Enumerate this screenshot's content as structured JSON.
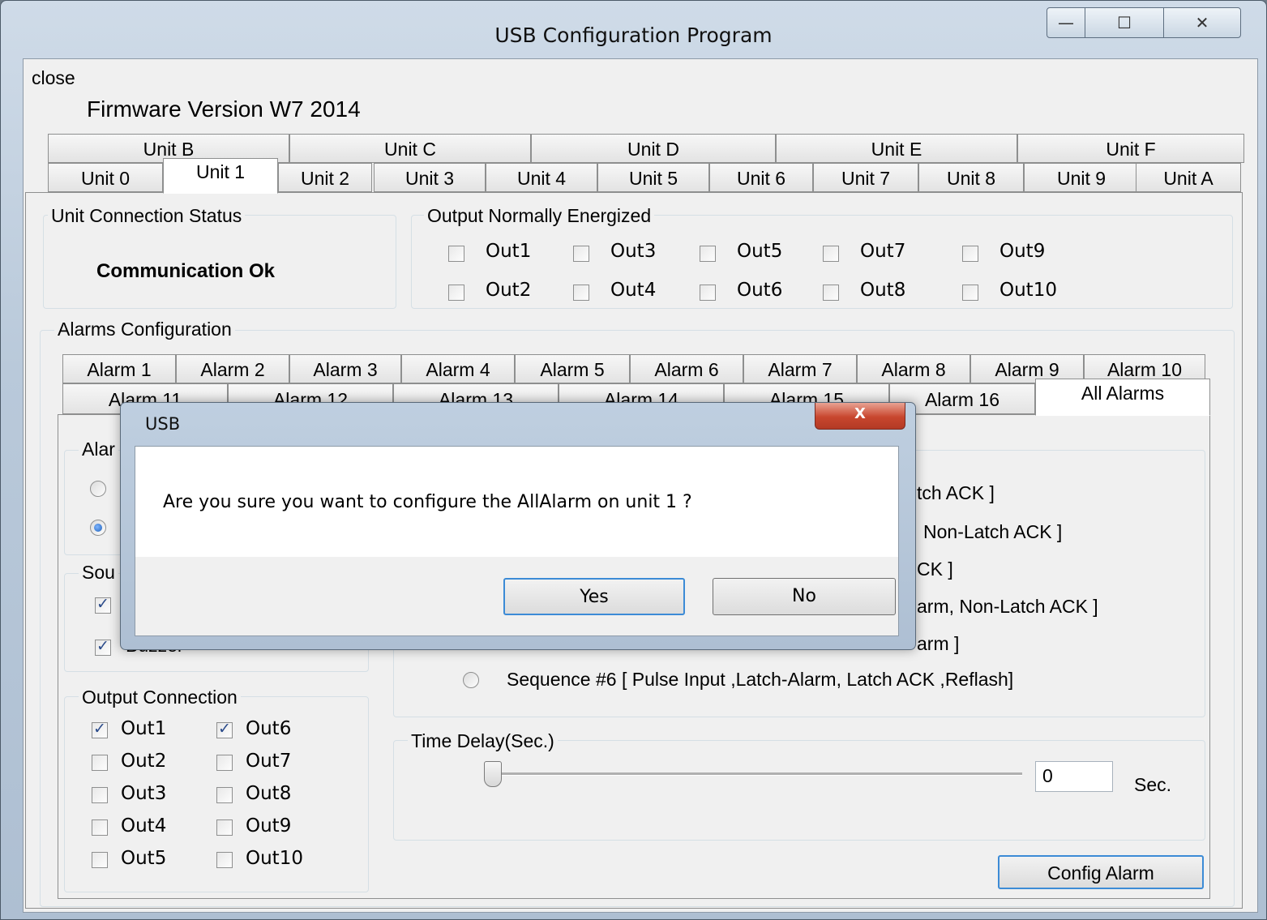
{
  "window": {
    "title": "USB Configuration Program",
    "minimize_glyph": "—",
    "maximize_glyph": "☐",
    "close_glyph": "✕"
  },
  "menu": {
    "close": "close"
  },
  "firmware": "Firmware Version W7 2014",
  "unit_tabs_row1": [
    "Unit B",
    "Unit C",
    "Unit D",
    "Unit E",
    "Unit F"
  ],
  "unit_tabs_row2": [
    "Unit 0",
    "Unit 1",
    "Unit 2",
    "Unit 3",
    "Unit 4",
    "Unit 5",
    "Unit 6",
    "Unit 7",
    "Unit 8",
    "Unit 9",
    "Unit A"
  ],
  "selected_unit": "Unit 1",
  "connection": {
    "legend": "Unit Connection Status",
    "status": "Communication Ok"
  },
  "normally_energized": {
    "legend": "Output Normally Energized",
    "items": [
      "Out1",
      "Out3",
      "Out5",
      "Out7",
      "Out9",
      "Out2",
      "Out4",
      "Out6",
      "Out8",
      "Out10"
    ],
    "checked": [
      false,
      false,
      false,
      false,
      false,
      false,
      false,
      false,
      false,
      false
    ]
  },
  "alarms": {
    "legend": "Alarms Configuration",
    "tabs_row1": [
      "Alarm 1",
      "Alarm 2",
      "Alarm 3",
      "Alarm 4",
      "Alarm 5",
      "Alarm 6",
      "Alarm 7",
      "Alarm 8",
      "Alarm 9",
      "Alarm 10"
    ],
    "tabs_row2": [
      "Alarm 11",
      "Alarm 12",
      "Alarm 13",
      "Alarm 14",
      "Alarm 15",
      "Alarm 16",
      "All Alarms"
    ],
    "selected_tab": "All Alarms"
  },
  "alarm_group_partial": "Alar",
  "sound_group_partial": "Sou",
  "buzzer_partial": "Buzzer",
  "sequence": {
    "visible_fragments": [
      "tch ACK ]",
      "Non-Latch ACK ]",
      "CK ]",
      "arm, Non-Latch ACK ]",
      "arm ]"
    ],
    "seq6": "Sequence #6 [ Pulse Input ,Latch-Alarm, Latch ACK ,Reflash]"
  },
  "output_connection": {
    "legend": "Output Connection",
    "col1": [
      "Out1",
      "Out2",
      "Out3",
      "Out4",
      "Out5"
    ],
    "col2": [
      "Out6",
      "Out7",
      "Out8",
      "Out9",
      "Out10"
    ],
    "col1_checked": [
      true,
      false,
      false,
      false,
      false
    ],
    "col2_checked": [
      true,
      false,
      false,
      false,
      false
    ]
  },
  "time_delay": {
    "legend": "Time Delay(Sec.)",
    "value": "0",
    "unit": "Sec.",
    "slider_fraction": 0
  },
  "config_button": "Config Alarm",
  "dialog": {
    "title": "USB",
    "message": "Are you sure you want to configure the AllAlarm on unit 1 ?",
    "yes": "Yes",
    "no": "No",
    "close_glyph": "X"
  }
}
